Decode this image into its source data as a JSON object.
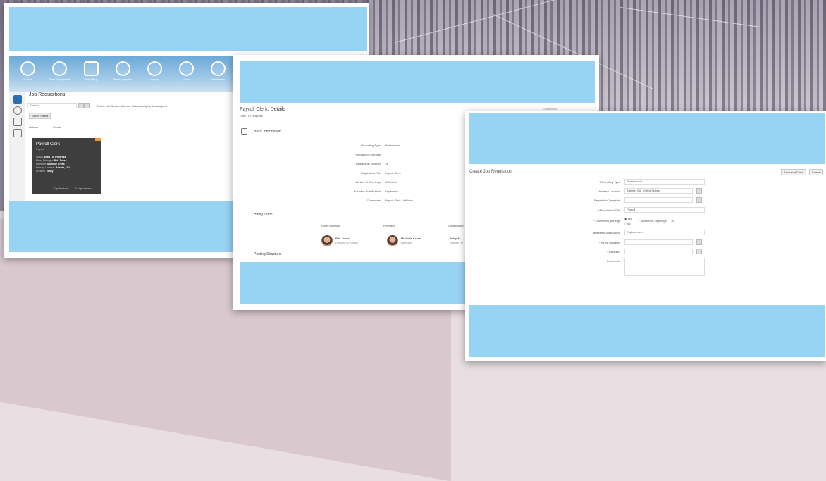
{
  "window1": {
    "nav_items": [
      {
        "label": "Me Team",
        "icon": "team-icon"
      },
      {
        "label": "Talent Management",
        "icon": "talent-icon"
      },
      {
        "label": "Team Filings",
        "icon": "filings-icon"
      },
      {
        "label": "Talent Acquisition",
        "icon": "acquisition-icon"
      },
      {
        "label": "Learning",
        "icon": "learning-icon"
      },
      {
        "label": "Actions",
        "icon": "actions-icon"
      },
      {
        "label": "Performance",
        "icon": "performance-icon"
      }
    ],
    "page_title": "Job Requisitions",
    "search_placeholder": "Search",
    "filter_text": "Saved Filters",
    "filter_chips": "Active, Not Shown: Current, Acknowledged, Unassigned",
    "actions_label": "Actions",
    "create_label": "Create",
    "card": {
      "title": "Payroll Clerk",
      "subtitle": "Payroll",
      "rows": [
        {
          "k": "Status",
          "v": "Draft - In Progress"
        },
        {
          "k": "Hiring Manager",
          "v": "Phil Jones"
        },
        {
          "k": "Recruiter",
          "v": "Michelle Kress"
        },
        {
          "k": "Primary Location",
          "v": "Atlanta, USA"
        },
        {
          "k": "Created",
          "v": "Today"
        }
      ],
      "footer_left": "0 Applications",
      "footer_right": "0 Unprocessed"
    }
  },
  "window2": {
    "title": "Payroll Clerk: Details",
    "status": "Draft - In Progress",
    "section_basic": "Basic Information",
    "fields": [
      {
        "k": "Recruiting Type",
        "v": "Professional"
      },
      {
        "k": "Requisition Template",
        "v": ""
      },
      {
        "k": "Requisition Number",
        "v": "34"
      },
      {
        "k": "Requisition Title",
        "v": "Payroll Clerk"
      },
      {
        "k": "Number of Openings",
        "v": "Unlimited"
      },
      {
        "k": "Business Justification",
        "v": "Expansion"
      },
      {
        "k": "Comments",
        "v": "Payroll Clerk - full time"
      }
    ],
    "section_hiring": "Hiring Team",
    "team_headers": [
      "Hiring Manager",
      "Recruiter",
      "Collaborator"
    ],
    "team": [
      {
        "name": "Phil Jones",
        "role": "Director of Payroll"
      },
      {
        "name": "Michelle Kress",
        "role": "Recruiter"
      },
      {
        "name": "Betty Ar",
        "role": "Human Re"
      }
    ],
    "section_posting": "Posting Structure",
    "top_right": "Edit    Actions"
  },
  "window3": {
    "title": "Create Job Requisition",
    "btn_save": "Save and Close",
    "btn_cancel": "Cancel",
    "fields": [
      {
        "k": "* Recruiting Type",
        "v": "Professional"
      },
      {
        "k": "* Primary Location",
        "v": "Atlanta, GA, United States"
      },
      {
        "k": "Requisition Template",
        "v": ""
      },
      {
        "k": "* Requisition Title",
        "v": "Payroll"
      },
      {
        "k": "* Unlimited Openings",
        "v": "Yes"
      },
      {
        "k": "Business Justification",
        "v": "Replacement"
      },
      {
        "k": "* Hiring Manager",
        "v": ""
      },
      {
        "k": "* Recruiter",
        "v": ""
      },
      {
        "k": "Comments",
        "v": ""
      }
    ],
    "openings_no": "No",
    "openings_count_label": "* Number of Openings",
    "openings_count": "16"
  },
  "colors": {
    "placeholder_blue": "#97d3f3",
    "nav_blue": "#6aa9d8",
    "accent_orange": "#f39c2b"
  }
}
